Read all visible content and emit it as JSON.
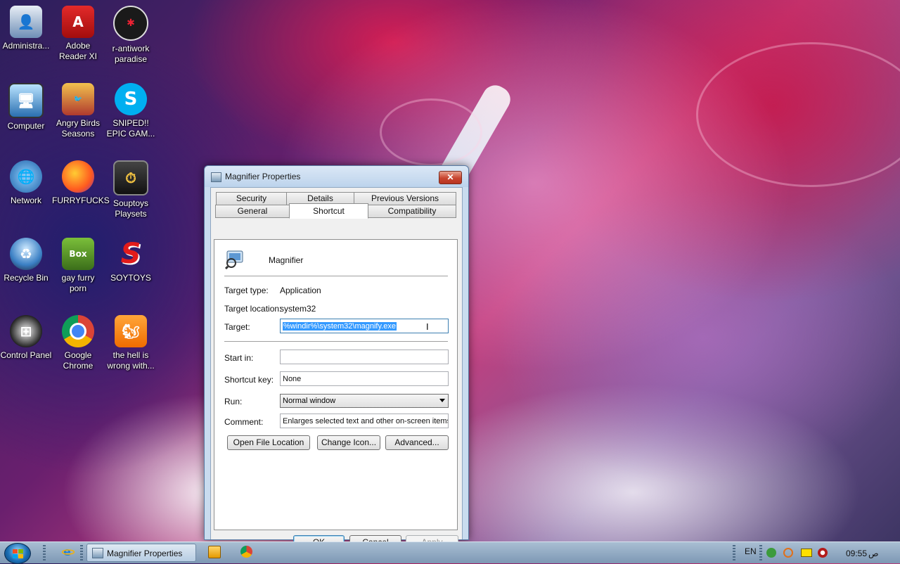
{
  "desktop": {
    "icons": [
      {
        "label": "Administra...",
        "icon": "admin-user-icon"
      },
      {
        "label": "Adobe Reader XI",
        "icon": "adobe-reader-icon"
      },
      {
        "label": "r-antiwork paradise",
        "icon": "reddit-icon"
      },
      {
        "label": "Computer",
        "icon": "computer-icon"
      },
      {
        "label": "Angry Birds Seasons",
        "icon": "angry-birds-icon"
      },
      {
        "label": "SNIPED!! EPIC GAM...",
        "icon": "skype-icon"
      },
      {
        "label": "Network",
        "icon": "network-icon"
      },
      {
        "label": "FURRYFUCKS",
        "icon": "firefox-icon"
      },
      {
        "label": "Souptoys Playsets",
        "icon": "souptoys-icon"
      },
      {
        "label": "Recycle Bin",
        "icon": "recycle-bin-icon"
      },
      {
        "label": "gay furry porn",
        "icon": "box-bear-icon"
      },
      {
        "label": "SOYTOYS",
        "icon": "soytoys-icon"
      },
      {
        "label": "Control Panel",
        "icon": "control-panel-icon"
      },
      {
        "label": "Google Chrome",
        "icon": "chrome-icon"
      },
      {
        "label": "the hell is wrong with...",
        "icon": "uc-browser-icon"
      }
    ]
  },
  "dialog": {
    "title": "Magnifier Properties",
    "close_glyph": "✕",
    "tabs_back": [
      "Security",
      "Details",
      "Previous Versions"
    ],
    "tabs_front": [
      "General",
      "Shortcut",
      "Compatibility"
    ],
    "active_tab": "Shortcut",
    "app_name": "Magnifier",
    "target_type_label": "Target type:",
    "target_type_value": "Application",
    "target_location_label": "Target location:",
    "target_location_value": "system32",
    "target_label": "Target:",
    "target_value": "%windir%\\system32\\magnify.exe",
    "start_in_label": "Start in:",
    "start_in_value": "",
    "shortcut_key_label": "Shortcut key:",
    "shortcut_key_value": "None",
    "run_label": "Run:",
    "run_value": "Normal window",
    "comment_label": "Comment:",
    "comment_value": "Enlarges selected text and other on-screen items f",
    "btn_open_location": "Open File Location",
    "btn_change_icon": "Change Icon...",
    "btn_advanced": "Advanced...",
    "btn_ok": "OK",
    "btn_cancel": "Cancel",
    "btn_apply": "Apply"
  },
  "taskbar": {
    "active_window_label": "Magnifier Properties",
    "language": "EN",
    "time": "09:55",
    "ampm": "ص"
  },
  "colors": {
    "selection": "#3399ff",
    "close_button": "#c8452f",
    "taskbar": "#8fa9c3"
  }
}
